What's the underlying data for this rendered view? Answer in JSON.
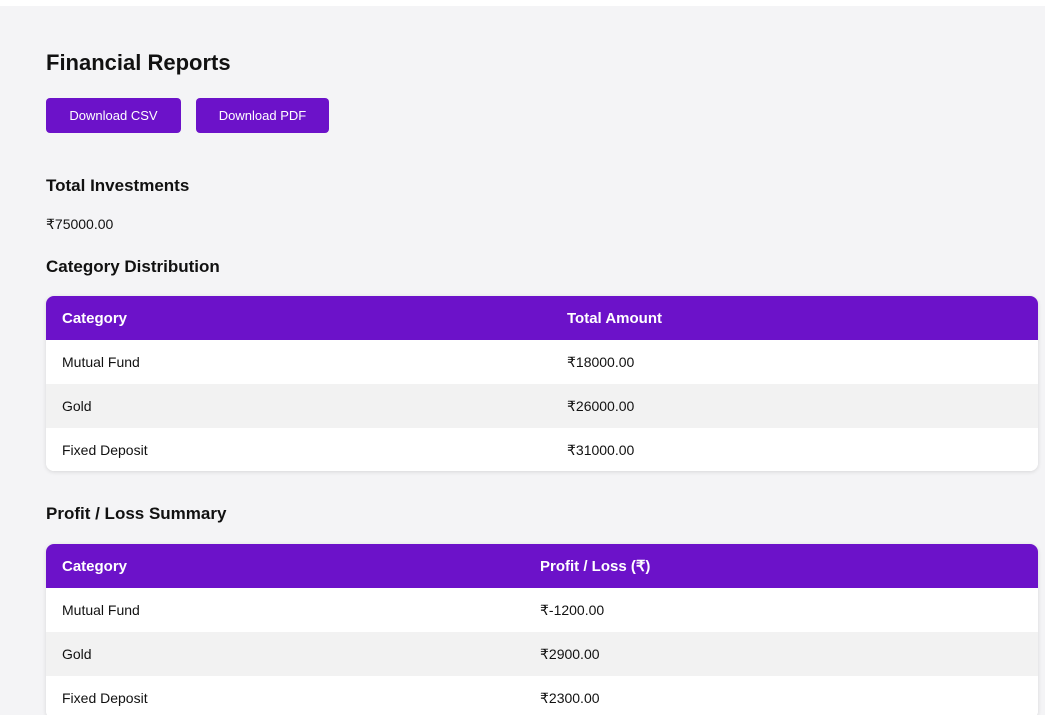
{
  "page": {
    "title": "Financial Reports"
  },
  "actions": {
    "download_csv": "Download CSV",
    "download_pdf": "Download PDF"
  },
  "total_investments": {
    "heading": "Total Investments",
    "value": "₹75000.00"
  },
  "category_distribution": {
    "heading": "Category Distribution",
    "columns": [
      "Category",
      "Total Amount"
    ],
    "rows": [
      {
        "category": "Mutual Fund",
        "amount": "₹18000.00"
      },
      {
        "category": "Gold",
        "amount": "₹26000.00"
      },
      {
        "category": "Fixed Deposit",
        "amount": "₹31000.00"
      }
    ]
  },
  "profit_loss_summary": {
    "heading": "Profit / Loss Summary",
    "columns": [
      "Category",
      "Profit / Loss (₹)"
    ],
    "rows": [
      {
        "category": "Mutual Fund",
        "value": "₹-1200.00"
      },
      {
        "category": "Gold",
        "value": "₹2900.00"
      },
      {
        "category": "Fixed Deposit",
        "value": "₹2300.00"
      }
    ]
  },
  "colors": {
    "accent": "#6c12c9",
    "page_background": "#f4f4f6",
    "row_alt": "#f2f2f2"
  }
}
